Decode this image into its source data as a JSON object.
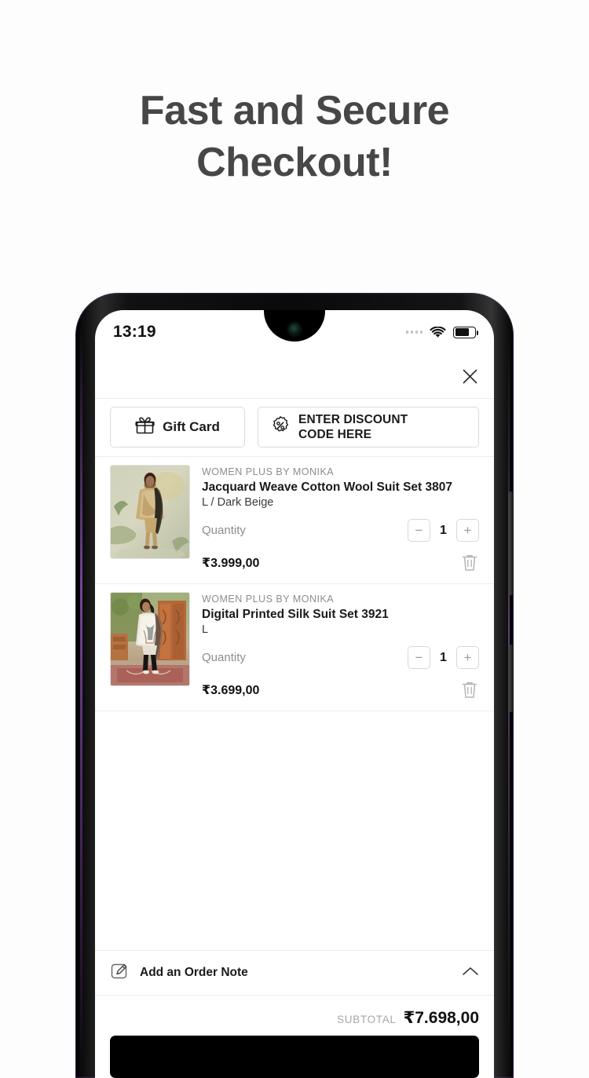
{
  "headline": {
    "line1": "Fast and Secure",
    "line2": "Checkout!"
  },
  "status_bar": {
    "time": "13:19",
    "signal_icon": "signal-dots-icon",
    "wifi_icon": "wifi-icon",
    "battery_icon": "battery-icon"
  },
  "header": {
    "close_icon": "close-icon"
  },
  "promo": {
    "gift_card": {
      "label": "Gift Card",
      "icon": "gift-icon"
    },
    "discount": {
      "label": "ENTER DISCOUNT CODE HERE",
      "line1": "ENTER DISCOUNT",
      "line2": "CODE HERE",
      "icon": "percent-badge-icon"
    }
  },
  "cart": {
    "quantity_label": "Quantity",
    "decrease_label": "−",
    "increase_label": "+",
    "items": [
      {
        "vendor": "WOMEN PLUS BY MONIKA",
        "title": "Jacquard Weave Cotton Wool Suit Set 3807",
        "variant": "L / Dark Beige",
        "quantity": "1",
        "price": "₹3.999,00",
        "remove_icon": "trash-icon",
        "thumbnail": "model-in-dark-beige-jacquard-suit"
      },
      {
        "vendor": "WOMEN PLUS BY MONIKA",
        "title": "Digital Printed Silk Suit Set 3921",
        "variant": "L",
        "quantity": "1",
        "price": "₹3.699,00",
        "remove_icon": "trash-icon",
        "thumbnail": "model-in-digital-printed-silk-suit"
      }
    ]
  },
  "footer": {
    "order_note": {
      "label": "Add an Order Note",
      "icon": "pencil-square-icon",
      "chevron": "chevron-up-icon"
    },
    "subtotal_label": "SUBTOTAL",
    "subtotal_value": "₹7.698,00"
  },
  "colors": {
    "page_background": "#fdfdfd",
    "headline": "#474747",
    "text_primary": "#1a1a1a",
    "text_muted": "#8d8d8d",
    "border": "#dcdcdc",
    "cta": "#000000"
  }
}
